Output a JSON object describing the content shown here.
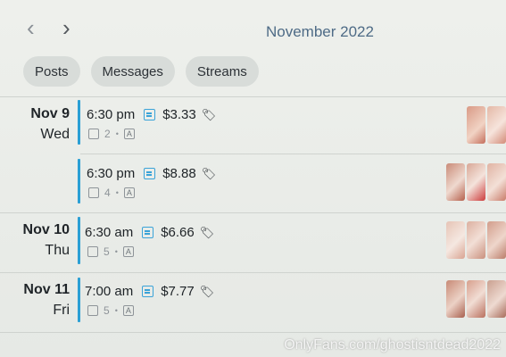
{
  "header": {
    "prev_icon": "chevron-left-icon",
    "next_icon": "chevron-right-icon",
    "month": "November 2022"
  },
  "tabs": [
    {
      "label": "Posts"
    },
    {
      "label": "Messages"
    },
    {
      "label": "Streams"
    }
  ],
  "entries": [
    {
      "date": "Nov 9",
      "weekday": "Wed",
      "time": "6:30 pm",
      "price": "$3.33",
      "media_count": "2",
      "thumbs": 2
    },
    {
      "date": "",
      "weekday": "",
      "time": "6:30 pm",
      "price": "$8.88",
      "media_count": "4",
      "thumbs": 3
    },
    {
      "date": "Nov 10",
      "weekday": "Thu",
      "time": "6:30 am",
      "price": "$6.66",
      "media_count": "5",
      "thumbs": 3
    },
    {
      "date": "Nov 11",
      "weekday": "Fri",
      "time": "7:00 am",
      "price": "$7.77",
      "media_count": "5",
      "thumbs": 3
    }
  ],
  "icons": {
    "message": "message-icon",
    "price_tag": "price-tag-icon",
    "image": "image-icon",
    "text": "text-icon"
  },
  "colors": {
    "accent": "#2a9fd4",
    "title": "#4e6b86"
  },
  "watermark": "OnlyFans.com/ghostisntdead2022"
}
